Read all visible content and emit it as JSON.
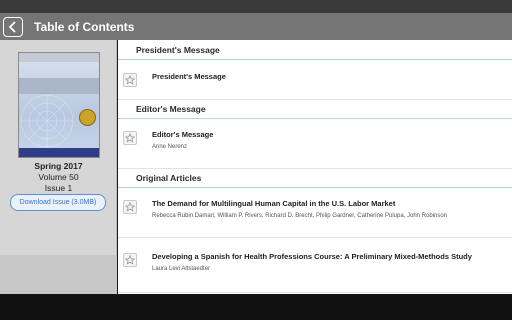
{
  "header": {
    "title": "Table of Contents",
    "back_icon": "chevron-left-icon"
  },
  "issue": {
    "season": "Spring 2017",
    "volume": "Volume 50",
    "number": "Issue 1",
    "download_label": "Download Issue (3.0MB)"
  },
  "sections": [
    {
      "heading": "President's Message",
      "articles": [
        {
          "title": "President's Message",
          "authors": ""
        }
      ]
    },
    {
      "heading": "Editor's Message",
      "articles": [
        {
          "title": "Editor's Message",
          "authors": "Anne Nerenz"
        }
      ]
    },
    {
      "heading": "Original Articles",
      "articles": [
        {
          "title": "The Demand for Multilingual Human Capital in the U.S. Labor Market",
          "authors": "Rebecca Rubin Damari, William P. Rivers, Richard D. Brecht, Philip Gardner, Catherine Pulupa, John Robinson"
        },
        {
          "title": "Developing a Spanish for Health Professions Course: A Preliminary Mixed-Methods Study",
          "authors": "Laura Levi Altstaedter"
        }
      ]
    }
  ],
  "colors": {
    "appbar": "#757575",
    "accent": "#3a74c9",
    "divider": "#b8d3f0"
  }
}
